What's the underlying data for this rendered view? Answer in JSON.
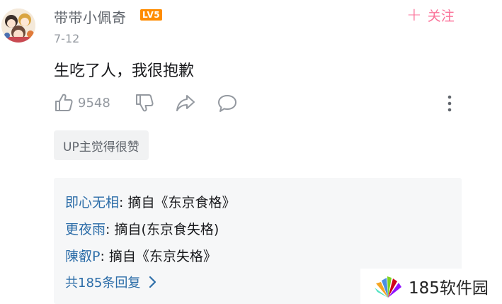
{
  "comment": {
    "username": "带带小佩奇",
    "level": "LV5",
    "follow_label": "关注",
    "date": "7-12",
    "content": "生吃了人，我很抱歉",
    "like_count": "9548",
    "up_tag": "UP主觉得很赞"
  },
  "replies": [
    {
      "user": "即心无相",
      "text": ": 摘自《东京食格》"
    },
    {
      "user": "更夜雨",
      "text": ": 摘自(东京食失格)"
    },
    {
      "user": "陳叡P",
      "text": ": 摘自《东京失格》"
    }
  ],
  "more_replies_label": "共185条回复",
  "watermark": "185软件园",
  "colors": {
    "accent_pink": "#fb7299",
    "link_blue": "#2c6da8",
    "level_orange": "#ff8c00",
    "muted_gray": "#9499a0"
  },
  "icons": [
    "avatar",
    "plus-icon",
    "thumbs-up-icon",
    "thumbs-down-icon",
    "share-icon",
    "comment-icon",
    "more-icon",
    "chevron-right-icon",
    "logo-icon"
  ]
}
